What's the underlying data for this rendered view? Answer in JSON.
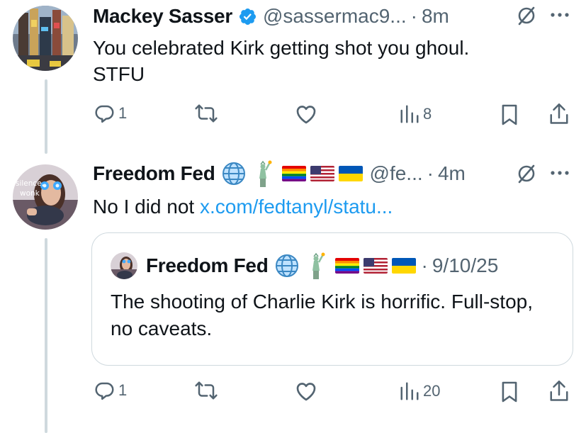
{
  "tweets": [
    {
      "name": "Mackey Sasser",
      "verified": true,
      "handle": "@sassermac9...",
      "separator": "·",
      "time": "8m",
      "text_line1": "You celebrated Kirk getting shot you ghoul.",
      "text_line2": "STFU",
      "actions": {
        "replies": "1",
        "reposts": "",
        "likes": "",
        "views": "8"
      }
    },
    {
      "name": "Freedom Fed",
      "handle": "@fe...",
      "separator": "·",
      "time": "4m",
      "text_prefix": "No I did not ",
      "link": "x.com/fedtanyl/statu...",
      "avatar_text": "silence, wonk",
      "name_emojis": [
        "globe-icon",
        "statue-of-liberty-icon",
        "rainbow-flag",
        "us-flag",
        "ukraine-flag"
      ],
      "quote": {
        "name": "Freedom Fed",
        "separator": "·",
        "date": "9/10/25",
        "text": "The shooting of Charlie Kirk is horrific. Full-stop, no caveats."
      },
      "actions": {
        "replies": "1",
        "reposts": "",
        "likes": "",
        "views": "20"
      }
    }
  ],
  "colors": {
    "accent": "#1d9bf0",
    "secondary_text": "#536471",
    "thread_line": "#cfd9de",
    "primary_text": "#0f1419"
  }
}
